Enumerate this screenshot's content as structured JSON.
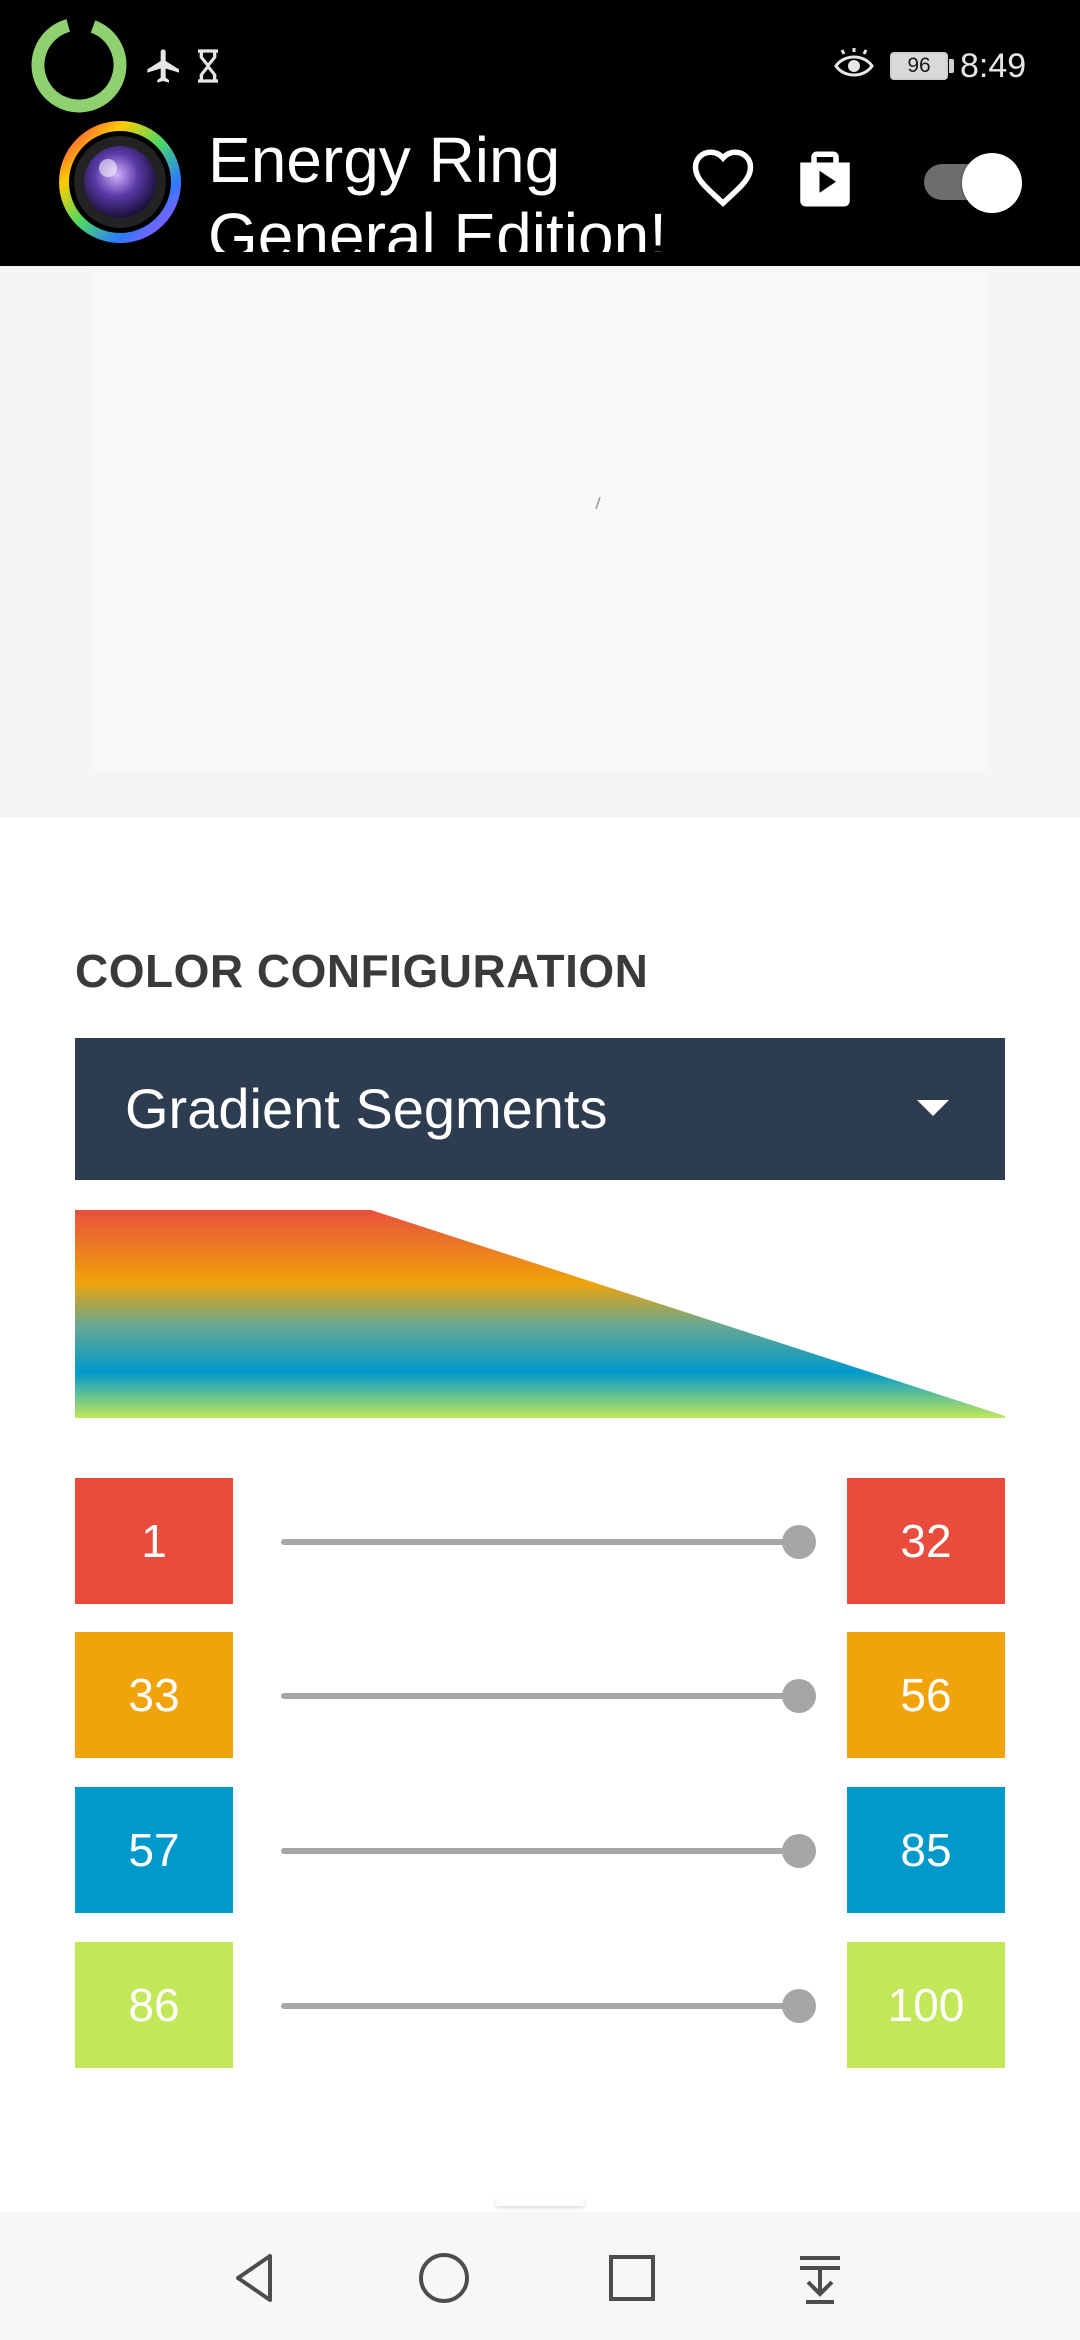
{
  "status_bar": {
    "time": "8:49",
    "battery": "96",
    "icons": [
      "ring-status-icon",
      "airplane-mode-icon",
      "hourglass-icon",
      "eye-comfort-icon",
      "battery-icon"
    ]
  },
  "app_bar": {
    "title_line1": "Energy Ring",
    "title_line2": "General Edition!",
    "icons": [
      "app-logo-icon",
      "heart-icon",
      "play-store-icon"
    ],
    "toggle_on": true
  },
  "color_config": {
    "section_title": "COLOR CONFIGURATION",
    "mode": "Gradient Segments",
    "segments": [
      {
        "start": "1",
        "end": "32",
        "color": "#e84c3d",
        "slider_value": 100
      },
      {
        "start": "33",
        "end": "56",
        "color": "#f0a30a",
        "slider_value": 100
      },
      {
        "start": "57",
        "end": "85",
        "color": "#0099cc",
        "slider_value": 100
      },
      {
        "start": "86",
        "end": "100",
        "color": "#c2e85a",
        "slider_value": 100
      }
    ]
  },
  "nav_bar": {
    "buttons": [
      "back-icon",
      "home-icon",
      "recents-icon",
      "notification-pull-icon"
    ]
  }
}
